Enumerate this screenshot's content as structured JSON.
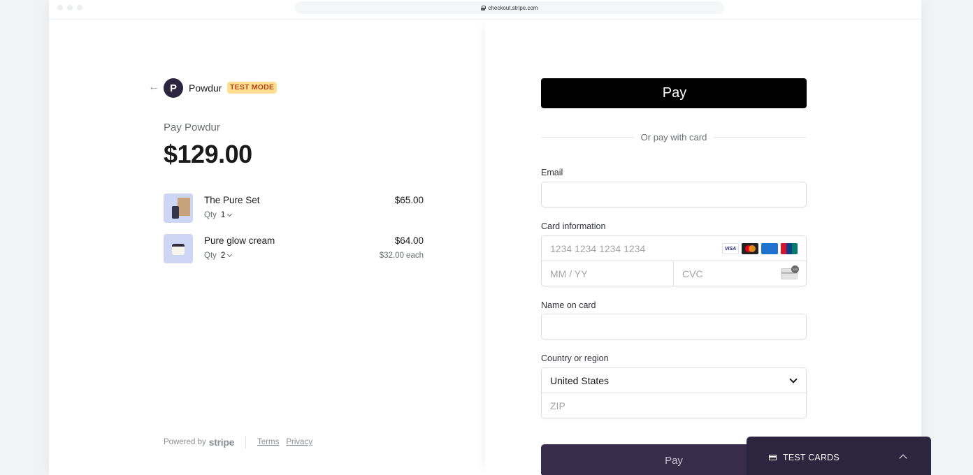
{
  "browser": {
    "url": "checkout.stripe.com"
  },
  "merchant": {
    "name": "Powdur",
    "logo_letter": "P",
    "badge": "TEST MODE",
    "back_icon": "←"
  },
  "summary": {
    "pay_label": "Pay Powdur",
    "total": "$129.00"
  },
  "items": [
    {
      "name": "The Pure Set",
      "qty_label": "Qty",
      "qty": "1",
      "price": "$65.00",
      "each": ""
    },
    {
      "name": "Pure glow cream",
      "qty_label": "Qty",
      "qty": "2",
      "price": "$64.00",
      "each": "$32.00 each"
    }
  ],
  "footer": {
    "powered_by": "Powered by",
    "brand": "stripe",
    "terms": "Terms",
    "privacy": "Privacy"
  },
  "payment": {
    "apple_pay_label": "Pay",
    "divider_text": "Or pay with card",
    "email_label": "Email",
    "email_value": "",
    "card_label": "Card information",
    "card_number_placeholder": "1234 1234 1234 1234",
    "expiry_placeholder": "MM / YY",
    "cvc_placeholder": "CVC",
    "card_brands": [
      "VISA",
      "MC",
      "AMEX",
      "UnionPay"
    ],
    "name_label": "Name on card",
    "name_value": "",
    "country_label": "Country or region",
    "country_value": "United States",
    "zip_placeholder": "ZIP",
    "pay_button": "Pay"
  },
  "test_cards": {
    "label": "TEST CARDS"
  },
  "colors": {
    "brand_dark": "#2b2540",
    "pay_button": "#372c49",
    "badge_bg": "#ffde92",
    "badge_text": "#b3461b"
  }
}
